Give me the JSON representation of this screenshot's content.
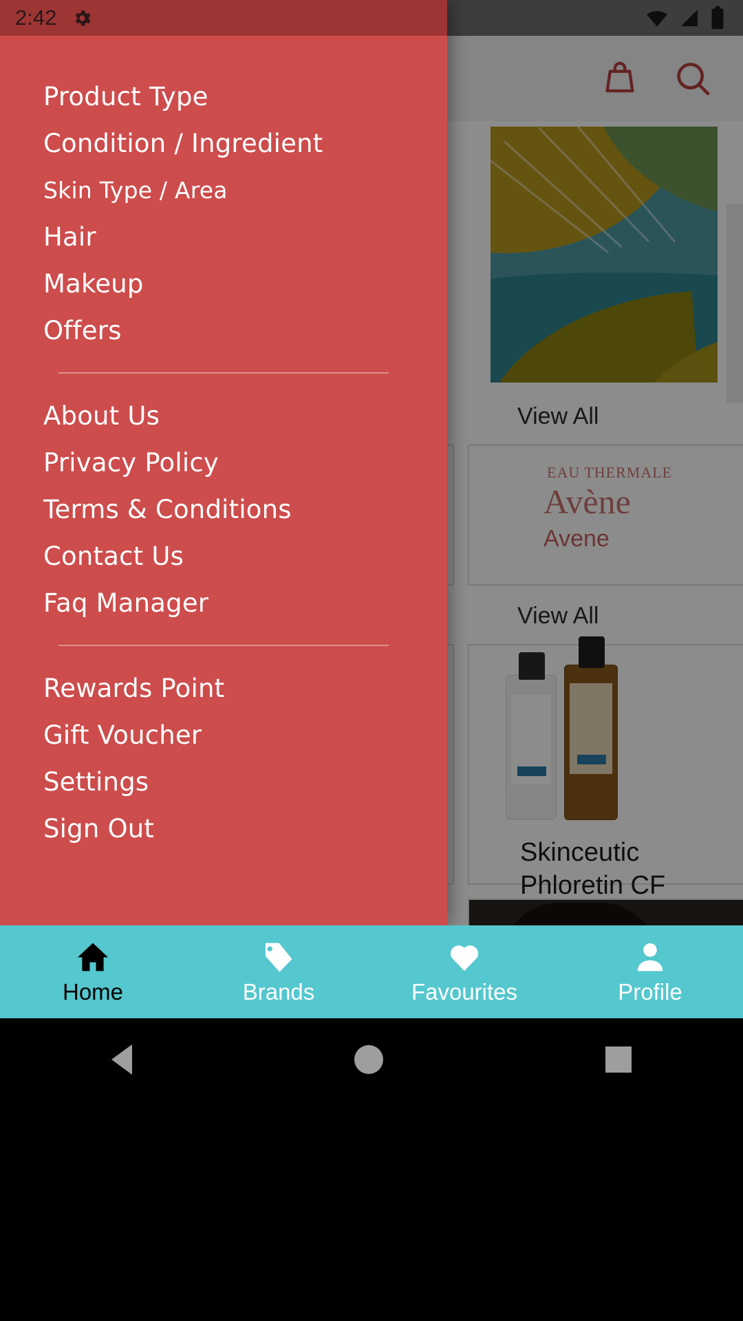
{
  "status_bar": {
    "time": "2:42",
    "gear_icon": "gear-icon",
    "wifi_icon": "wifi-icon",
    "signal_icon": "signal-icon",
    "battery_icon": "battery-icon"
  },
  "drawer": {
    "groups": [
      {
        "items": [
          {
            "label": "Product Type",
            "size": "normal"
          },
          {
            "label": "Condition / Ingredient",
            "size": "normal"
          },
          {
            "label": "Skin Type / Area",
            "size": "small"
          },
          {
            "label": "Hair",
            "size": "normal"
          },
          {
            "label": "Makeup",
            "size": "normal"
          },
          {
            "label": "Offers",
            "size": "normal"
          }
        ]
      },
      {
        "items": [
          {
            "label": "About Us",
            "size": "normal"
          },
          {
            "label": "Privacy Policy",
            "size": "normal"
          },
          {
            "label": "Terms & Conditions",
            "size": "normal"
          },
          {
            "label": "Contact Us",
            "size": "normal"
          },
          {
            "label": "Faq Manager",
            "size": "normal"
          }
        ]
      },
      {
        "items": [
          {
            "label": "Rewards Point",
            "size": "normal"
          },
          {
            "label": "Gift Voucher",
            "size": "normal"
          },
          {
            "label": "Settings",
            "size": "normal"
          },
          {
            "label": "Sign Out",
            "size": "normal"
          }
        ]
      }
    ]
  },
  "background": {
    "appbar": {
      "bag_icon": "shopping-bag-icon",
      "search_icon": "search-icon"
    },
    "view_all_1": "View All",
    "view_all_2": "View All",
    "brand_card": {
      "eyebrow": "EAU THERMALE",
      "title": "Avène",
      "name": "Avene"
    },
    "product_card": {
      "name_line1": "Skinceutic",
      "name_line2": "Phloretin CF"
    }
  },
  "tab_bar": {
    "tabs": [
      {
        "label": "Home",
        "icon": "home-icon",
        "active": true
      },
      {
        "label": "Brands",
        "icon": "tag-icon",
        "active": false
      },
      {
        "label": "Favourites",
        "icon": "heart-icon",
        "active": false
      },
      {
        "label": "Profile",
        "icon": "person-icon",
        "active": false
      }
    ]
  },
  "android_nav": {
    "back_icon": "back-triangle-icon",
    "home_icon": "home-circle-icon",
    "recents_icon": "recents-square-icon"
  },
  "colors": {
    "drawer_red": "#cd4c4c",
    "status_red": "#9d3535",
    "tab_teal": "#55c7ce",
    "accent_brand": "#b5403f"
  }
}
